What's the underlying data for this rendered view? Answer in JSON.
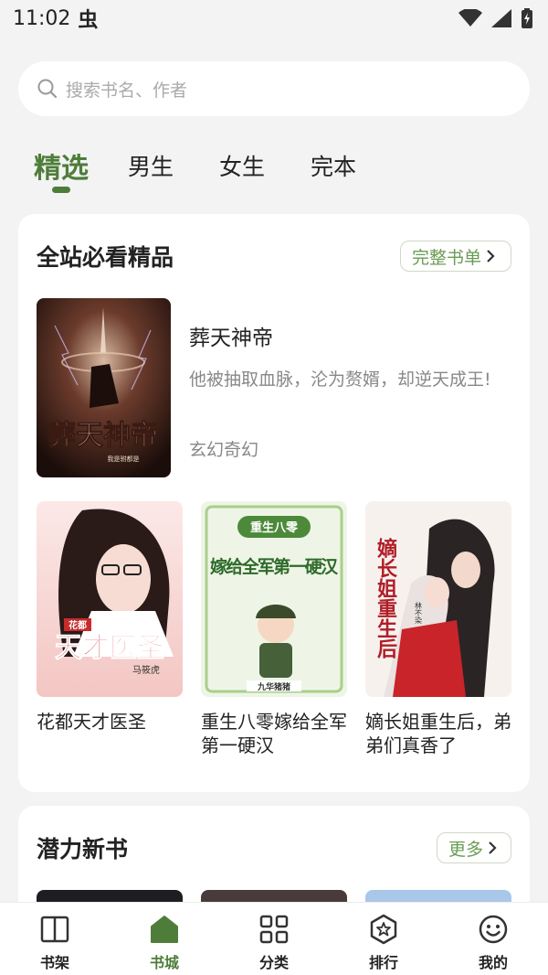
{
  "status_bar": {
    "time": "11:02",
    "notification_glyph": "虫"
  },
  "search": {
    "placeholder": "搜索书名、作者"
  },
  "tabs": [
    {
      "label": "精选",
      "active": true
    },
    {
      "label": "男生",
      "active": false
    },
    {
      "label": "女生",
      "active": false
    },
    {
      "label": "完本",
      "active": false
    }
  ],
  "section1": {
    "title": "全站必看精品",
    "more_label": "完整书单",
    "featured": {
      "title": "葬天神帝",
      "desc": "他被抽取血脉，沦为赘婿，却逆天成王!",
      "genre": "玄幻奇幻",
      "cover_text": "葬天神帝",
      "cover_author": "我是驸都是"
    },
    "books": [
      {
        "title": "花都天才医圣",
        "cover_text": "天才医圣",
        "cover_tag": "花都",
        "cover_author": "马筱虎"
      },
      {
        "title": "重生八零嫁给全军第一硬汉",
        "cover_text_top": "重生八零",
        "cover_text": "嫁给全军第一硬汉",
        "cover_author": "九华猪猪"
      },
      {
        "title": "嫡长姐重生后，弟弟们真香了",
        "cover_text": "嫡长姐重生后",
        "cover_author": "林不染"
      }
    ]
  },
  "section2": {
    "title": "潜力新书",
    "more_label": "更多"
  },
  "bottom_nav": [
    {
      "label": "书架",
      "icon": "book-icon",
      "active": false
    },
    {
      "label": "书城",
      "icon": "bookstore-icon",
      "active": true
    },
    {
      "label": "分类",
      "icon": "category-grid-icon",
      "active": false
    },
    {
      "label": "排行",
      "icon": "ranking-star-icon",
      "active": false
    },
    {
      "label": "我的",
      "icon": "smiley-face-icon",
      "active": false
    }
  ],
  "colors": {
    "accent": "#4e7d3a",
    "background": "#f3f3f3",
    "muted_text": "#888888"
  }
}
